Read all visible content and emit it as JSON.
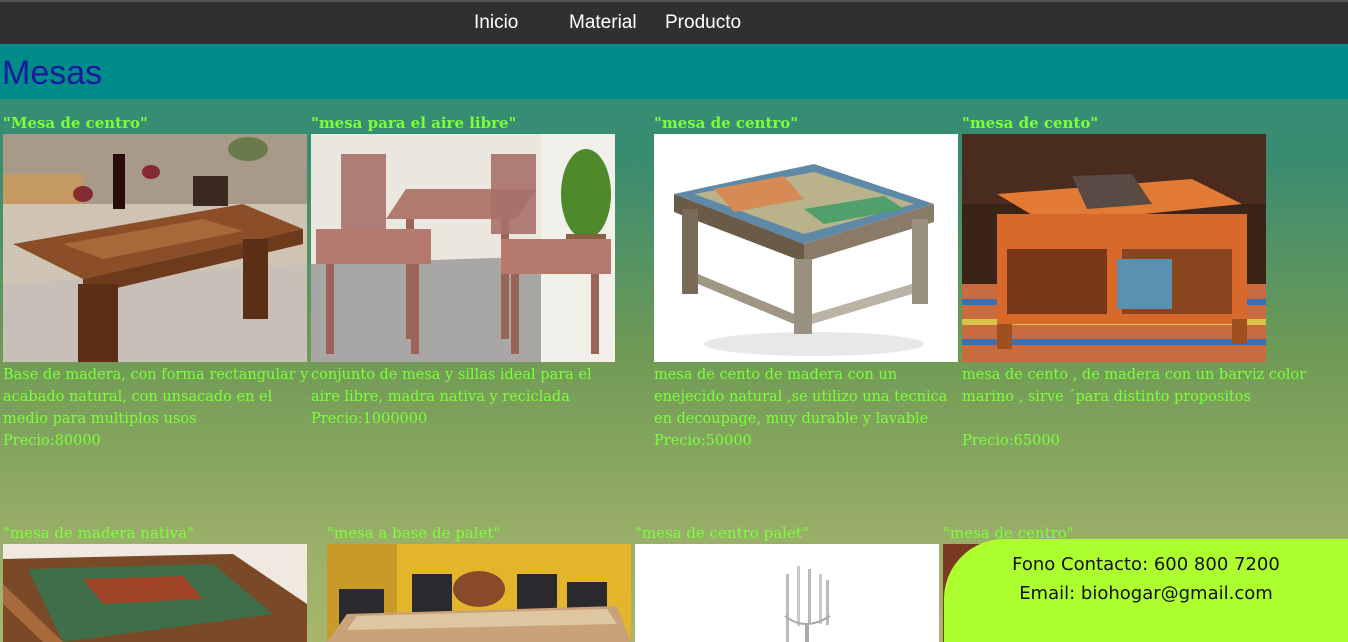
{
  "nav": {
    "items": [
      "Inicio",
      "Material",
      "Producto"
    ]
  },
  "header": {
    "title": "Mesas"
  },
  "products_row1": [
    {
      "title": "\"Mesa de centro\"",
      "desc": "Base de madera, con forma rectangular y acabado natural, con unsacado en el medio para multiplos usos",
      "price": "Precio:80000"
    },
    {
      "title": "\"mesa para el aire libre\"",
      "desc": "conjunto de mesa y sillas ideal para el aire libre, madra nativa y reciclada",
      "price": "Precio:1000000"
    },
    {
      "title": "\"mesa de centro\"",
      "desc": "mesa de cento de madera con un enejecido natural ,se utilizo una tecnica en decoupage, muy durable y lavable",
      "price": "Precio:50000"
    },
    {
      "title": "\"mesa de cento\"",
      "desc": "mesa de cento , de madera con un barviz color marino , sirve ´para distinto propositos",
      "price": "Precio:65000"
    }
  ],
  "products_row2": [
    {
      "title": "\"mesa de madera nativa\""
    },
    {
      "title": "\"mesa a base de palet\""
    },
    {
      "title": "\"mesa de centro palet\""
    },
    {
      "title": "\"mesa de centro\""
    }
  ],
  "contact": {
    "phone": "Fono Contacto: 600 800 7200",
    "email": "Email: biohogar@gmail.com"
  },
  "colors": {
    "nav_bg": "#303030",
    "banner_bg": "#008b8b",
    "title_color": "#1a1a9a",
    "text_green": "#7cff3a",
    "contact_bg": "#adff2f"
  }
}
